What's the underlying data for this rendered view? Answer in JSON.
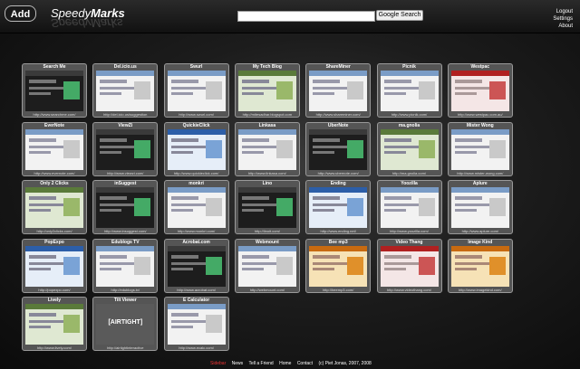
{
  "header": {
    "add_label": "Add",
    "logo_part1": "Speedy",
    "logo_part2": "Marks",
    "search_placeholder": "",
    "search_button": "Google Search",
    "nav": [
      "Logout",
      "Settings",
      "About"
    ]
  },
  "tiles": [
    {
      "title": "Search Me",
      "url": "http://www.searchme.com/",
      "theme": "dark"
    },
    {
      "title": "Del.icio.us",
      "url": "http://del.icio.us/suggestion",
      "theme": "light"
    },
    {
      "title": "Swurl",
      "url": "http://www.swurl.com/",
      "theme": "light"
    },
    {
      "title": "My Tech Blog",
      "url": "http://mitesadhar.blogspot.com",
      "theme": "green"
    },
    {
      "title": "ShareMiner",
      "url": "http://www.shareminer.com/",
      "theme": "light"
    },
    {
      "title": "Picnik",
      "url": "http://www.picnik.com/",
      "theme": "light"
    },
    {
      "title": "Westpac",
      "url": "http://www.westpac.com.au/",
      "theme": "red"
    },
    {
      "title": "EverNote",
      "url": "http://www.evernote.com/",
      "theme": "light"
    },
    {
      "title": "ViewZi",
      "url": "http://www.viewzi.com/",
      "theme": "dark"
    },
    {
      "title": "QuickieClick",
      "url": "http://www.quickieclick.com/",
      "theme": "blue"
    },
    {
      "title": "Linkasa",
      "url": "http://www.linkasa.com/",
      "theme": "light"
    },
    {
      "title": "UberNote",
      "url": "http://www.ubernote.com/",
      "theme": "dark"
    },
    {
      "title": "ma.gnolia",
      "url": "http://ma.gnolia.com/",
      "theme": "green"
    },
    {
      "title": "Mister Wong",
      "url": "http://www.mister-wong.com/",
      "theme": "light"
    },
    {
      "title": "Only 2 Clicks",
      "url": "http://only2clicks.com/",
      "theme": "green"
    },
    {
      "title": "inSuggest",
      "url": "http://www.insuggest.com/",
      "theme": "dark"
    },
    {
      "title": "monkri",
      "url": "http://www.monkri.com/",
      "theme": "light"
    },
    {
      "title": "Lino",
      "url": "http://linoit.com/",
      "theme": "dark"
    },
    {
      "title": "Ending",
      "url": "http://www.ending.net/",
      "theme": "blue"
    },
    {
      "title": "Yoozilla",
      "url": "http://www.yoozilla.com/",
      "theme": "light"
    },
    {
      "title": "Aplure",
      "url": "http://www.aplure.com/",
      "theme": "light"
    },
    {
      "title": "PopExpo",
      "url": "http://popexpo.com/",
      "theme": "blue"
    },
    {
      "title": "Edublogs TV",
      "url": "http://edublogs.tv/",
      "theme": "light"
    },
    {
      "title": "Acrobat.com",
      "url": "http://www.acrobat.com/",
      "theme": "dark"
    },
    {
      "title": "Webmount",
      "url": "http://webmount.com/",
      "theme": "light"
    },
    {
      "title": "Bee mp3",
      "url": "http://beemp3.com/",
      "theme": "orange"
    },
    {
      "title": "Video Thang",
      "url": "http://www.videothang.com/",
      "theme": "red"
    },
    {
      "title": "Image Kind",
      "url": "http://www.imagekind.com/",
      "theme": "orange"
    },
    {
      "title": "Lively",
      "url": "http://www.lively.com/",
      "theme": "green"
    },
    {
      "title": "Tilt Viewer",
      "url": "http://airtightinteractive",
      "theme": "gray"
    },
    {
      "title": "E Calculator",
      "url": "http://www.ecalc.com/",
      "theme": "light"
    }
  ],
  "tile_thumb_text": {
    "Tilt Viewer": "[AIRTIGHT]"
  },
  "footer": {
    "links": [
      "Sidebar",
      "News",
      "Tell a Friend",
      "Home",
      "Contact"
    ],
    "copyright": "(c) Piet Jonas, 2007, 2008"
  },
  "colors": {
    "footer_active": "#ee3333",
    "tile_border": "#999999"
  }
}
